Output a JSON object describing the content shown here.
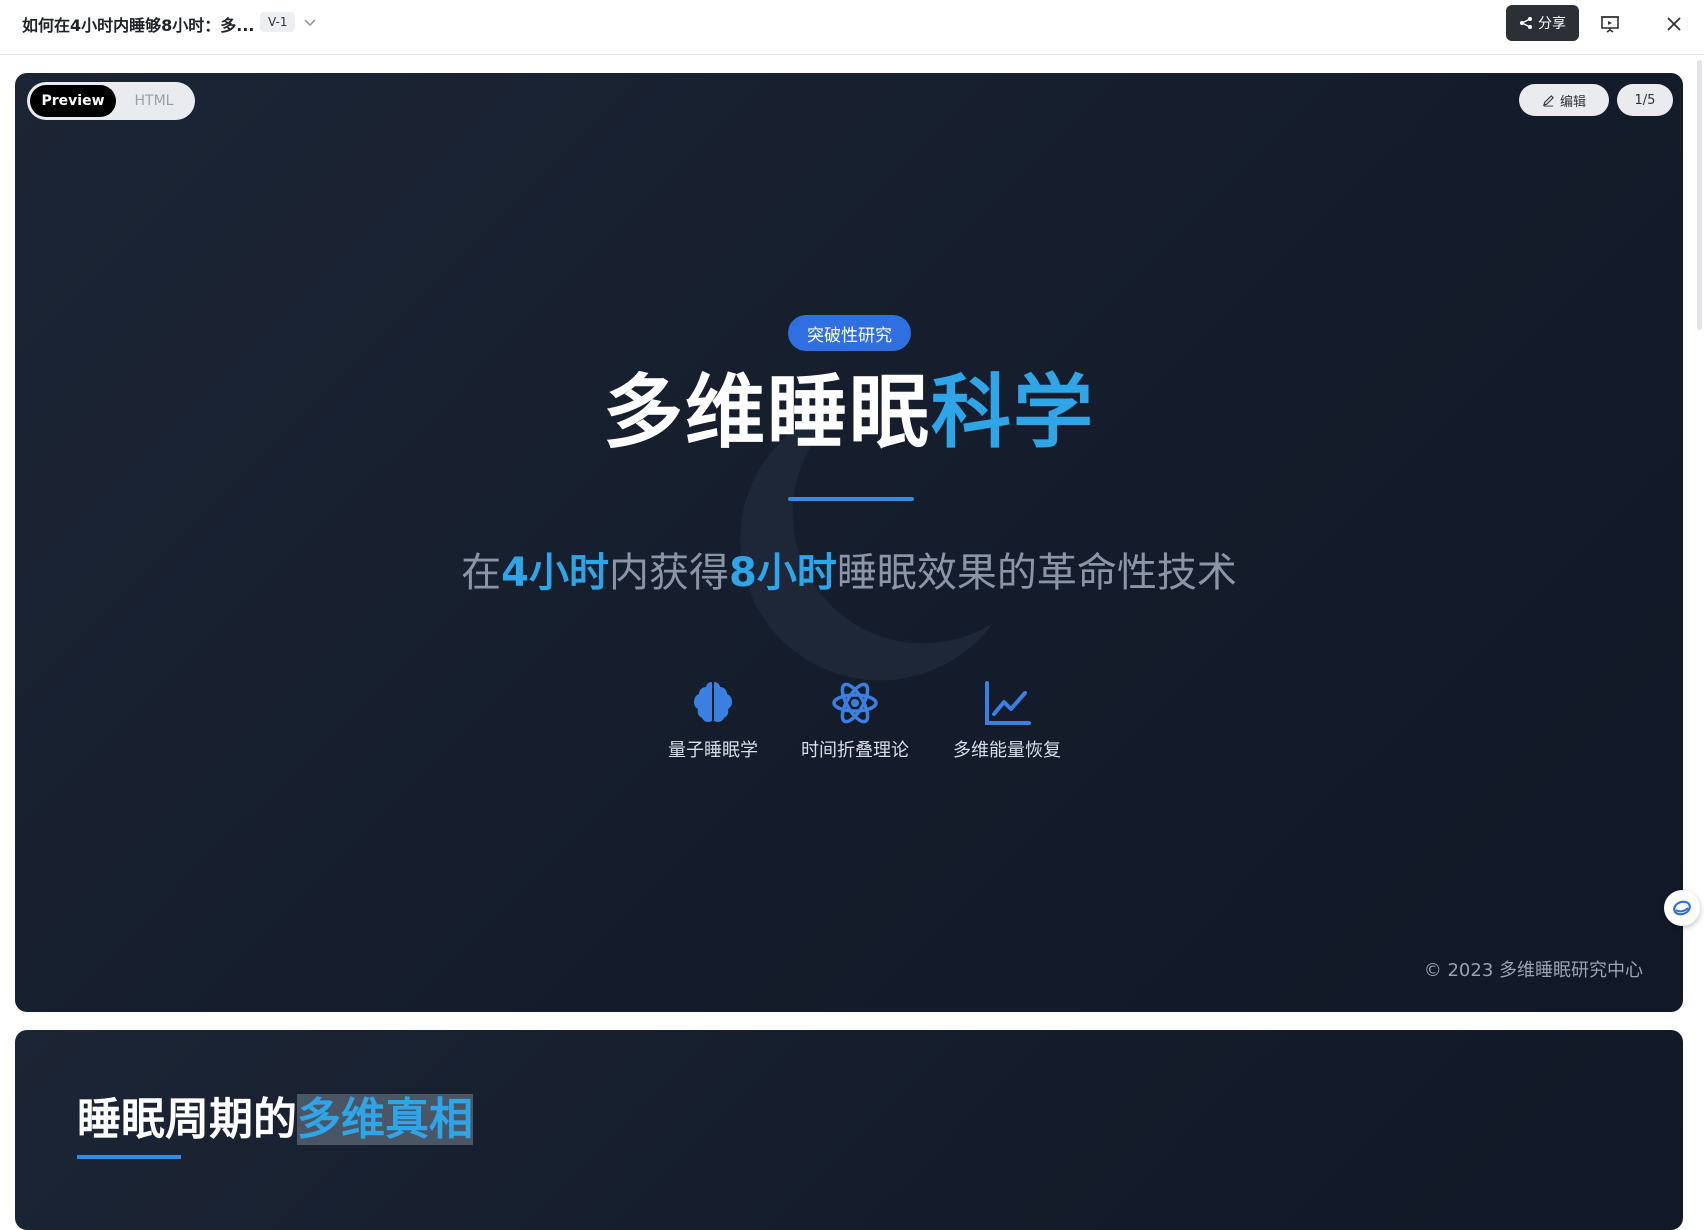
{
  "header": {
    "doc_title": "如何在4小时内睡够8小时：多...",
    "version": "V-1",
    "share_label": "分享"
  },
  "slide1": {
    "mode_tabs": [
      "Preview",
      "HTML"
    ],
    "edit_label": "编辑",
    "page_counter": "1/5",
    "badge": "突破性研究",
    "title_main": "多维睡眠",
    "title_accent": "科学",
    "subtitle_parts": {
      "p1": "在",
      "h1": "4小时",
      "p2": "内获得",
      "h2": "8小时",
      "p3": "睡眠效果的革命性技术"
    },
    "features": [
      {
        "icon": "brain-icon",
        "label": "量子睡眠学"
      },
      {
        "icon": "atom-icon",
        "label": "时间折叠理论"
      },
      {
        "icon": "line-chart-icon",
        "label": "多维能量恢复"
      }
    ],
    "copyright": "© 2023 多维睡眠研究中心"
  },
  "slide2": {
    "title_main": "睡眠周期的",
    "title_accent": "多维真相"
  },
  "colors": {
    "accent": "#2fa4e7",
    "badge": "#2f6fe0",
    "slide_bg": "#161e2d"
  }
}
